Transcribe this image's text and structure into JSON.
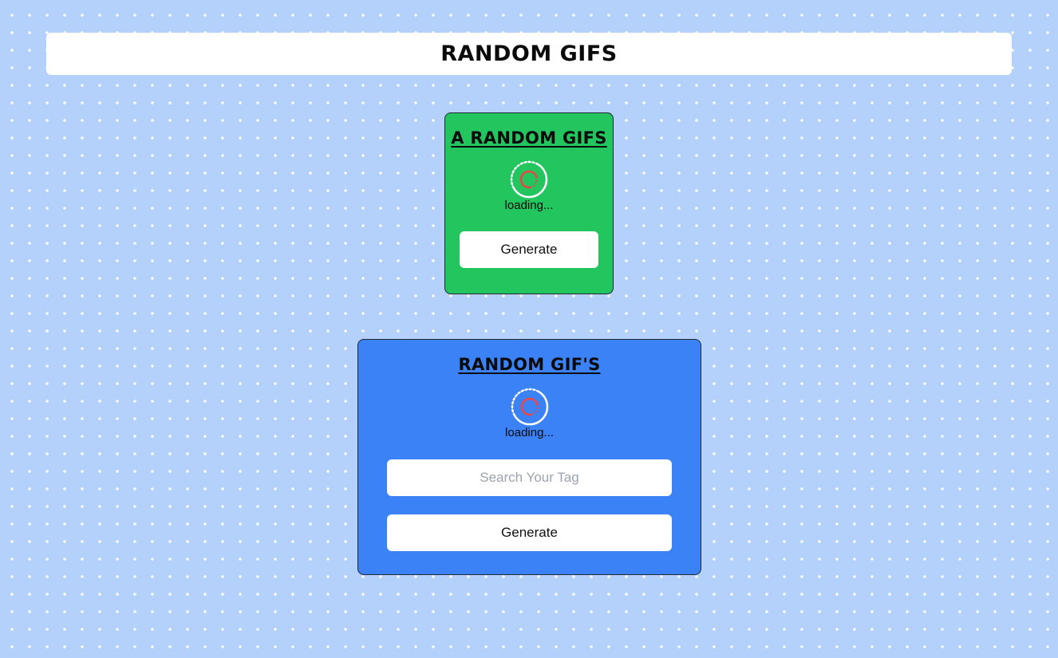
{
  "header": {
    "title": "RANDOM GIFS"
  },
  "random_card": {
    "title": "A RANDOM GIFS",
    "loading_text": "loading...",
    "generate_label": "Generate",
    "color": "#22c55e"
  },
  "tag_card": {
    "title": "RANDOM GIF'S",
    "loading_text": "loading...",
    "search_value": "",
    "search_placeholder": "Search Your Tag",
    "generate_label": "Generate",
    "color": "#3b82f6"
  },
  "spinner": {
    "icon": "loading-spinner-icon",
    "outer_color": "#ffffff",
    "inner_color": "#ef4444"
  },
  "page": {
    "background": "#b3d1fa"
  }
}
